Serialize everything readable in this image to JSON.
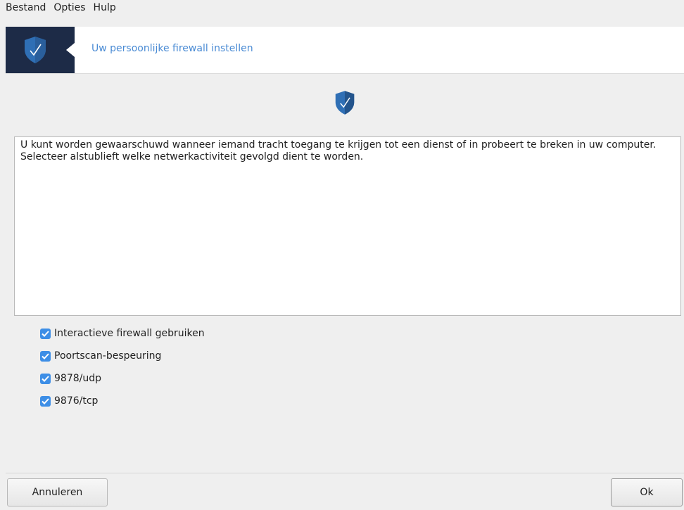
{
  "menu": [
    "Bestand",
    "Opties",
    "Hulp"
  ],
  "banner": {
    "title": "Uw persoonlijke firewall instellen",
    "icon": "shield-check-icon"
  },
  "description": {
    "line1": "U kunt worden gewaarschuwd wanneer iemand tracht toegang te krijgen tot een dienst of in probeert te breken in uw computer.",
    "line2": "Selecteer alstublieft welke netwerkactiviteit gevolgd dient te worden."
  },
  "options": [
    {
      "label": "Interactieve firewall gebruiken",
      "checked": true
    },
    {
      "label": "Poortscan-bespeuring",
      "checked": true
    },
    {
      "label": "9878/udp",
      "checked": true
    },
    {
      "label": "9876/tcp",
      "checked": true
    }
  ],
  "buttons": {
    "cancel": "Annuleren",
    "ok": "Ok"
  },
  "colors": {
    "accent": "#3d8ee6",
    "banner_dark": "#1d2b47",
    "title_blue": "#4a8bd4"
  }
}
